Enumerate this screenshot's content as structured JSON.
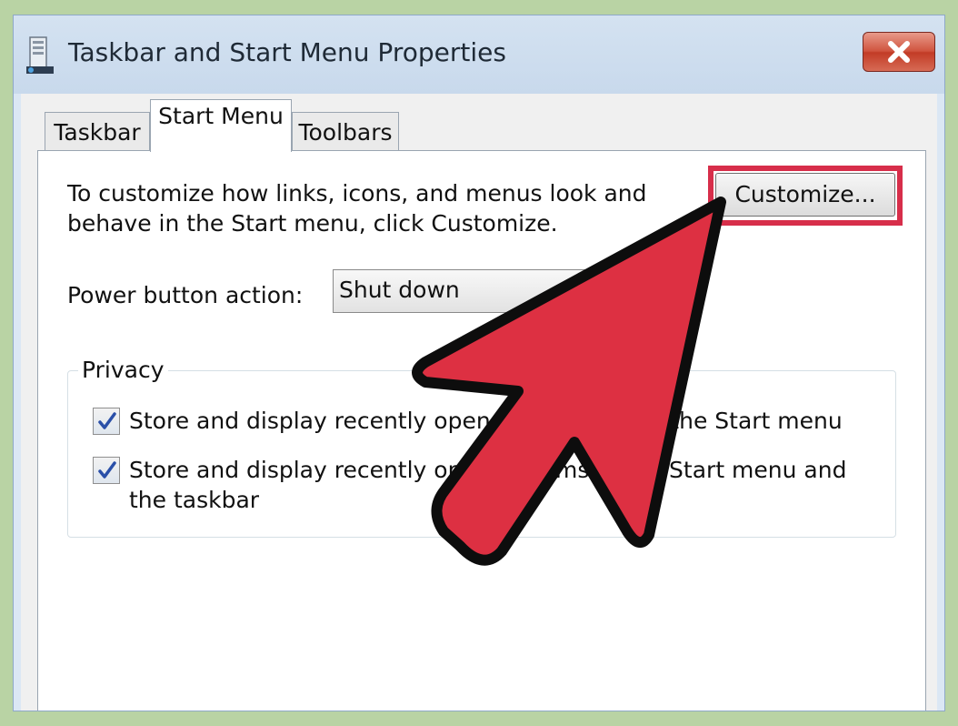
{
  "window": {
    "title": "Taskbar and Start Menu Properties",
    "close_glyph": "✕"
  },
  "tabs": [
    {
      "label": "Taskbar",
      "active": false
    },
    {
      "label": "Start Menu",
      "active": true
    },
    {
      "label": "Toolbars",
      "active": false
    }
  ],
  "start_menu": {
    "description": "To customize how links, icons, and menus look and behave in the Start menu, click Customize.",
    "customize_label": "Customize...",
    "power_label": "Power button action:",
    "power_value": "Shut down",
    "privacy": {
      "legend": "Privacy",
      "items": [
        {
          "label": "Store and display recently opened programs in the Start menu",
          "checked": true
        },
        {
          "label": "Store and display recently opened items in the Start menu and the taskbar",
          "checked": true
        }
      ]
    }
  },
  "icons": {
    "window": "taskbar-properties-icon",
    "close": "close-icon",
    "check": "checkmark-icon",
    "pointer": "red-arrow-pointer"
  },
  "colors": {
    "highlight": "#d72e4a",
    "arrow_fill": "#dd3042",
    "close_button": "#c9442e",
    "frame_background": "#b9d3a4"
  }
}
